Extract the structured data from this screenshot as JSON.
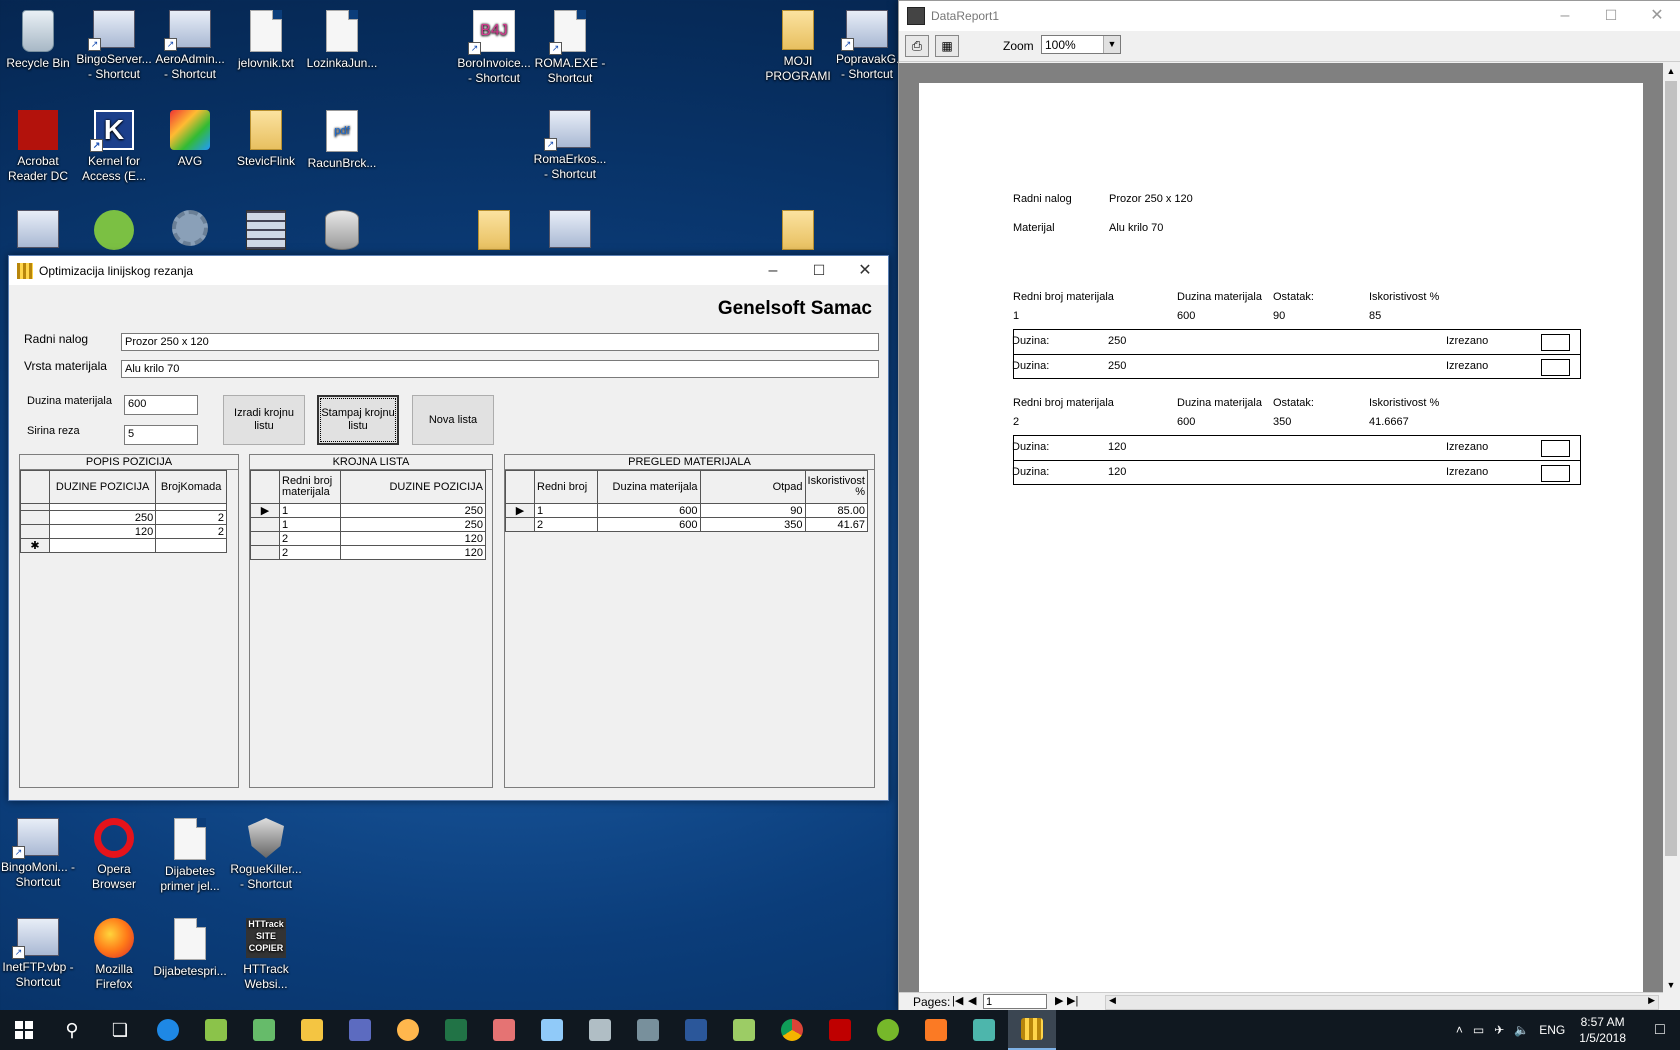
{
  "desktop_icons": [
    {
      "label": "Recycle Bin",
      "type": "bin"
    },
    {
      "label": "BingoServer... - Shortcut",
      "type": "app"
    },
    {
      "label": "AeroAdmin... - Shortcut",
      "type": "app"
    },
    {
      "label": "jelovnik.txt",
      "type": "doc"
    },
    {
      "label": "LozinkaJun...",
      "type": "doc"
    },
    {
      "label": "BoroInvoice... - Shortcut",
      "type": "b4j"
    },
    {
      "label": "ROMA.EXE - Shortcut",
      "type": "doc"
    },
    {
      "label": "MOJI PROGRAMI",
      "type": "folder"
    },
    {
      "label": "PopravakG... - Shortcut",
      "type": "app"
    },
    {
      "label": "Acrobat Reader DC",
      "type": "red"
    },
    {
      "label": "Kernel for Access (E...",
      "type": "kblue"
    },
    {
      "label": "AVG",
      "type": "avg"
    },
    {
      "label": "StevicFlink",
      "type": "folder"
    },
    {
      "label": "RacunBrck...",
      "type": "pdf"
    },
    {
      "label": "RomaErkos... - Shortcut",
      "type": "app"
    },
    {
      "label": "BingoMoni... - Shortcut",
      "type": "app"
    },
    {
      "label": "Opera Browser",
      "type": "opera"
    },
    {
      "label": "Dijabetes primer jel...",
      "type": "doc"
    },
    {
      "label": "RogueKiller... - Shortcut",
      "type": "shield"
    },
    {
      "label": "InetFTP.vbp - Shortcut",
      "type": "app"
    },
    {
      "label": "Mozilla Firefox",
      "type": "firefox"
    },
    {
      "label": "Dijabetespri...",
      "type": "doc"
    },
    {
      "label": "HTTrack Websi...",
      "type": "httrack"
    }
  ],
  "opt_window": {
    "title": "Optimizacija linijskog rezanja",
    "brand": "Genelsoft Samac",
    "radni_nalog_label": "Radni nalog",
    "radni_nalog_value": "Prozor 250 x 120",
    "vrsta_label": "Vrsta materijala",
    "vrsta_value": "Alu krilo 70",
    "duzina_label": "Duzina materijala",
    "duzina_value": "600",
    "sirina_label": "Sirina reza",
    "sirina_value": "5",
    "btn_izradi": "Izradi krojnu listu",
    "btn_stampaj": "Stampaj krojnu listu",
    "btn_nova": "Nova lista",
    "popis": {
      "caption": "POPIS POZICIJA",
      "headers": [
        "DUZINE POZICIJA",
        "BrojKomada"
      ],
      "rows": [
        [
          "250",
          "2"
        ],
        [
          "120",
          "2"
        ]
      ],
      "new_row_marker": "✱"
    },
    "krojna": {
      "caption": "KROJNA LISTA",
      "headers": [
        "Redni broj materijala",
        "DUZINE POZICIJA"
      ],
      "rows": [
        [
          "1",
          "250"
        ],
        [
          "1",
          "250"
        ],
        [
          "2",
          "120"
        ],
        [
          "2",
          "120"
        ]
      ]
    },
    "pregled": {
      "caption": "PREGLED MATERIJALA",
      "headers": [
        "Redni broj",
        "Duzina materijala",
        "Otpad",
        "Iskoristivost %"
      ],
      "rows": [
        [
          "1",
          "600",
          "90",
          "85.00"
        ],
        [
          "2",
          "600",
          "350",
          "41.67"
        ]
      ]
    }
  },
  "report_window": {
    "title": "DataReport1",
    "zoom_label": "Zoom",
    "zoom_value": "100%",
    "pages_label": "Pages:",
    "page_value": "1",
    "radni_nalog_label": "Radni nalog",
    "radni_nalog_value": "Prozor 250 x 120",
    "materijal_label": "Materijal",
    "materijal_value": "Alu krilo 70",
    "col_headers": [
      "Redni broj materijala",
      "Duzina materijala",
      "Ostatak:",
      "Iskoristivost %"
    ],
    "groups": [
      {
        "redni": "1",
        "duzina": "600",
        "ostatak": "90",
        "iskoristivost": "85",
        "items": [
          {
            "label": "Duzina:",
            "value": "250",
            "status": "Izrezano"
          },
          {
            "label": "Duzina:",
            "value": "250",
            "status": "Izrezano"
          }
        ]
      },
      {
        "redni": "2",
        "duzina": "600",
        "ostatak": "350",
        "iskoristivost": "41.6667",
        "items": [
          {
            "label": "Duzina:",
            "value": "120",
            "status": "Izrezano"
          },
          {
            "label": "Duzina:",
            "value": "120",
            "status": "Izrezano"
          }
        ]
      }
    ]
  },
  "taskbar": {
    "language": "ENG",
    "time": "8:57 AM",
    "date": "1/5/2018"
  },
  "colors": {
    "accent": "#0078d7",
    "desktop": "#0b3d7a",
    "taskbar": "#101820"
  }
}
